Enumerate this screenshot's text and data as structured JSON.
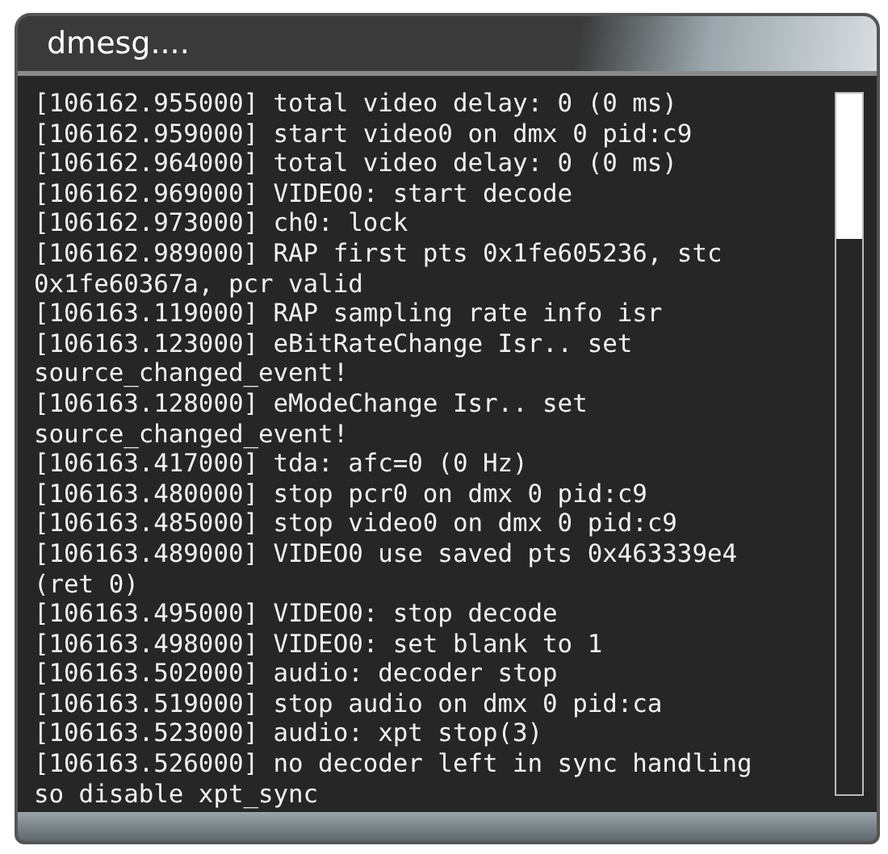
{
  "window": {
    "title": "dmesg...."
  },
  "log_lines": [
    "[106162.955000] total video delay: 0 (0 ms)",
    "[106162.959000] start video0 on dmx 0 pid:c9",
    "[106162.964000] total video delay: 0 (0 ms)",
    "[106162.969000] VIDEO0: start decode",
    "[106162.973000] ch0: lock",
    "[106162.989000] RAP first pts 0x1fe605236, stc",
    "0x1fe60367a, pcr valid",
    "[106163.119000] RAP sampling rate info isr",
    "[106163.123000] eBitRateChange Isr.. set",
    "source_changed_event!",
    "[106163.128000] eModeChange Isr.. set",
    "source_changed_event!",
    "[106163.417000] tda: afc=0 (0 Hz)",
    "[106163.480000] stop pcr0 on dmx 0 pid:c9",
    "[106163.485000] stop video0 on dmx 0 pid:c9",
    "[106163.489000] VIDEO0 use saved pts 0x463339e4",
    "(ret 0)",
    "[106163.495000] VIDEO0: stop decode",
    "[106163.498000] VIDEO0: set blank to 1",
    "[106163.502000] audio: decoder stop",
    "[106163.519000] stop audio on dmx 0 pid:ca",
    "[106163.523000] audio: xpt stop(3)",
    "[106163.526000] no decoder left in sync handling",
    "so disable xpt_sync"
  ]
}
